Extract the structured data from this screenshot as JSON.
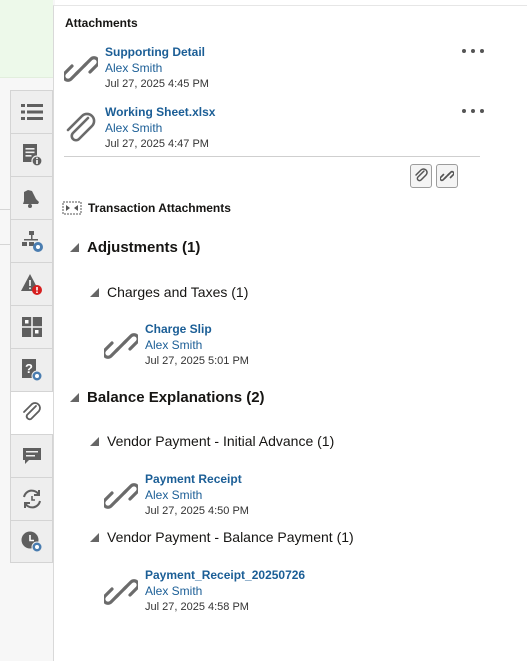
{
  "panel": {
    "title": "Attachments",
    "attachments": [
      {
        "name": "Supporting Detail",
        "user": "Alex Smith",
        "date": "Jul 27, 2025 4:45 PM",
        "icon": "link-icon"
      },
      {
        "name": "Working Sheet.xlsx",
        "user": "Alex Smith",
        "date": "Jul 27, 2025 4:47 PM",
        "icon": "paperclip-icon"
      }
    ],
    "toolbar": {
      "add_file_icon": "paperclip-icon",
      "add_link_icon": "link-icon"
    }
  },
  "transaction": {
    "header": "Transaction Attachments",
    "groups": [
      {
        "label": "Adjustments (1)",
        "children": [
          {
            "label": "Charges and Taxes (1)",
            "attachments": [
              {
                "name": "Charge Slip",
                "user": "Alex Smith",
                "date": "Jul 27, 2025 5:01 PM"
              }
            ]
          }
        ]
      },
      {
        "label": "Balance Explanations (2)",
        "children": [
          {
            "label": "Vendor Payment - Initial Advance (1)",
            "attachments": [
              {
                "name": "Payment Receipt",
                "user": "Alex Smith",
                "date": "Jul 27, 2025 4:50 PM"
              }
            ]
          },
          {
            "label": "Vendor Payment - Balance Payment (1)",
            "attachments": [
              {
                "name": "Payment_Receipt_20250726",
                "user": "Alex Smith",
                "date": "Jul 27, 2025 4:58 PM"
              }
            ]
          }
        ]
      }
    ]
  },
  "rail": {
    "tabs": [
      "list-icon",
      "document-info-icon",
      "bell-icon",
      "hierarchy-settings-icon",
      "warning-alert-icon",
      "adjustments-icon",
      "question-settings-icon",
      "paperclip-icon",
      "comment-icon",
      "sync-icon",
      "clock-settings-icon"
    ],
    "active": "paperclip-icon"
  },
  "colors": {
    "link": "#1b5e96",
    "accent_green_bg": "#edf9ea",
    "alert_red": "#d61f1f",
    "icon_grey": "#5f5f5f"
  }
}
